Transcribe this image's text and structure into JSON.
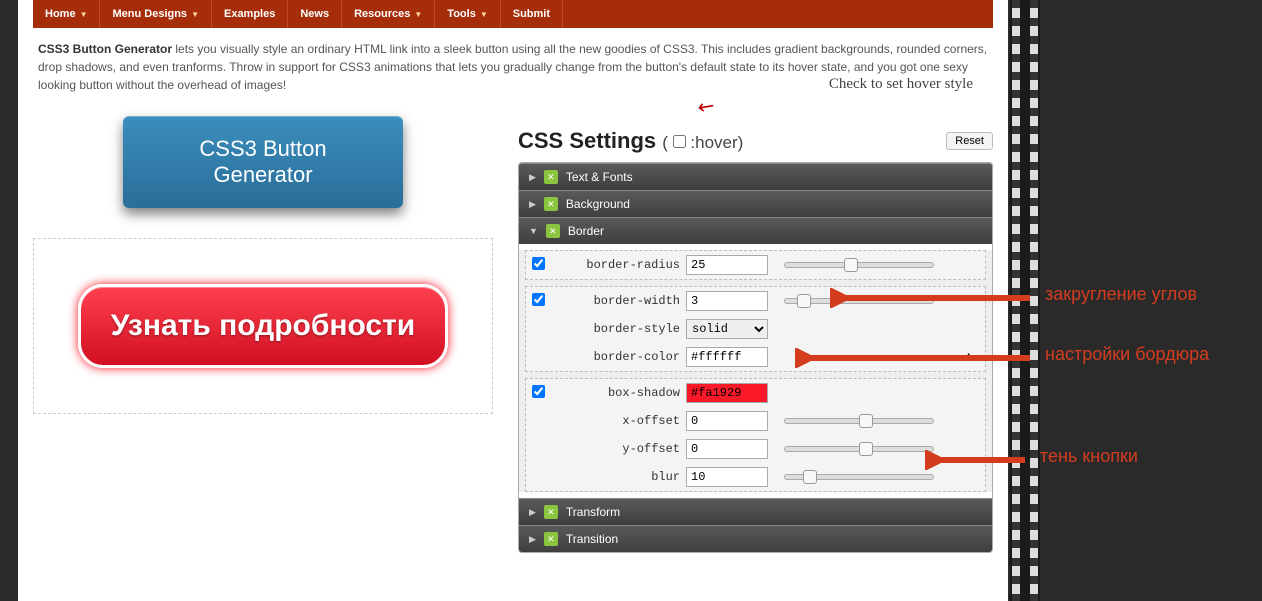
{
  "nav": [
    "Home",
    "Menu Designs",
    "Examples",
    "News",
    "Resources",
    "Tools",
    "Submit"
  ],
  "nav_has_dropdown": [
    true,
    true,
    false,
    false,
    true,
    true,
    false
  ],
  "intro_bold": "CSS3 Button Generator",
  "intro_text": " lets you visually style an ordinary HTML link into a sleek button using all the new goodies of CSS3. This includes gradient backgrounds, rounded corners, drop shadows, and even tranforms. Throw in support for CSS3 animations that lets you gradually change from the button's default state to its hover state, and you got one sexy looking button without the overhead of images!",
  "banner": "CSS3 Button Generator",
  "preview_button": "Узнать подробности",
  "hover_note": "Check to set hover style",
  "settings_title": "CSS Settings",
  "hover_label": ":hover",
  "reset": "Reset",
  "sections": {
    "text_fonts": "Text & Fonts",
    "background": "Background",
    "border": "Border",
    "transform": "Transform",
    "transition": "Transition"
  },
  "fields": {
    "border_radius": {
      "label": "border-radius",
      "value": "25",
      "slider": 40
    },
    "border_width": {
      "label": "border-width",
      "value": "3",
      "slider": 8
    },
    "border_style": {
      "label": "border-style",
      "value": "solid"
    },
    "border_color": {
      "label": "border-color",
      "value": "#ffffff"
    },
    "box_shadow": {
      "label": "box-shadow",
      "value": "#fa1929"
    },
    "x_offset": {
      "label": "x-offset",
      "value": "0",
      "slider": 50
    },
    "y_offset": {
      "label": "y-offset",
      "value": "0",
      "slider": 50
    },
    "blur": {
      "label": "blur",
      "value": "10",
      "slider": 12
    }
  },
  "annotations": {
    "corners": "закругление углов",
    "border": "настройки бордюра",
    "shadow": "тень кнопки"
  }
}
